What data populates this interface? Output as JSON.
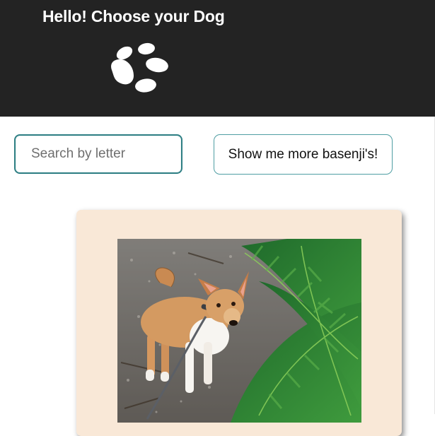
{
  "header": {
    "title": "Hello! Choose your Dog",
    "logo_icon": "paw-print-icon",
    "background_color": "#232323"
  },
  "search": {
    "placeholder": "Search by letter",
    "value": "",
    "border_color": "#2e7f84"
  },
  "more_button": {
    "label": "Show me more basenji's!",
    "border_color": "#4f9ea3"
  },
  "dog_card": {
    "background_color": "#f9e8d7",
    "image_subject": "basenji-dog-photo"
  }
}
